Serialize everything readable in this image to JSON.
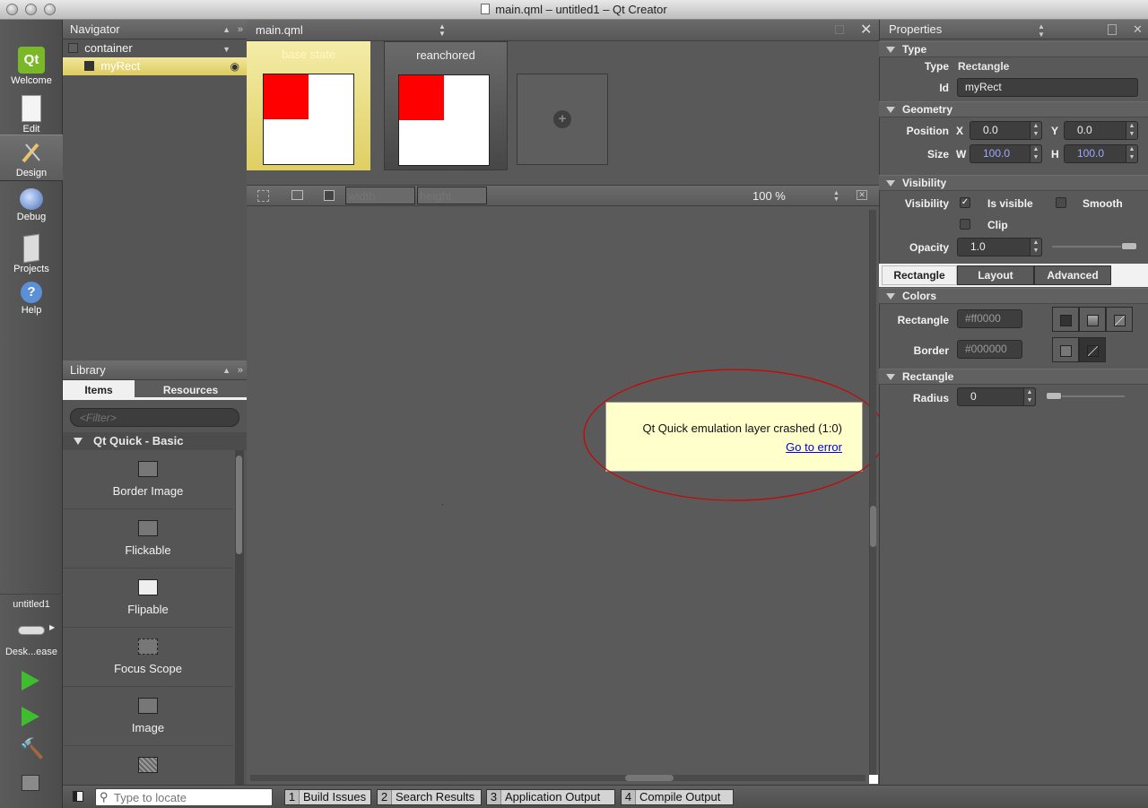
{
  "window": {
    "title": "main.qml – untitled1 – Qt Creator"
  },
  "modes": [
    {
      "label": "Welcome"
    },
    {
      "label": "Edit"
    },
    {
      "label": "Design"
    },
    {
      "label": "Debug"
    },
    {
      "label": "Projects"
    },
    {
      "label": "Help"
    }
  ],
  "modes_logo": "Qt",
  "kit": {
    "project": "untitled1",
    "target": "Desk...ease"
  },
  "navigator": {
    "title": "Navigator",
    "items": [
      {
        "label": "container"
      },
      {
        "label": "myRect"
      }
    ]
  },
  "library": {
    "title": "Library",
    "tabs": [
      "Items",
      "Resources"
    ],
    "filter_placeholder": "<Filter>",
    "group": "Qt Quick - Basic",
    "items": [
      {
        "label": "Border Image"
      },
      {
        "label": "Flickable"
      },
      {
        "label": "Flipable"
      },
      {
        "label": "Focus Scope"
      },
      {
        "label": "Image"
      }
    ]
  },
  "editor": {
    "file": "main.qml",
    "states": [
      {
        "label": "base state"
      },
      {
        "label": "reanchored"
      }
    ],
    "add_state_icon": "plus-circle-icon",
    "width_placeholder": "width",
    "height_placeholder": "height",
    "zoom": "100 %"
  },
  "error": {
    "message": "Qt Quick emulation layer crashed (1:0)",
    "link": "Go to error"
  },
  "properties": {
    "title": "Properties",
    "type_section": "Type",
    "type_label": "Type",
    "type_value": "Rectangle",
    "id_label": "Id",
    "id_value": "myRect",
    "geometry_section": "Geometry",
    "position_label": "Position",
    "x_label": "X",
    "x_value": "0.0",
    "y_label": "Y",
    "y_value": "0.0",
    "size_label": "Size",
    "w_label": "W",
    "w_value": "100.0",
    "h_label": "H",
    "h_value": "100.0",
    "visibility_section": "Visibility",
    "visibility_label": "Visibility",
    "is_visible": "Is visible",
    "smooth": "Smooth",
    "clip": "Clip",
    "opacity_label": "Opacity",
    "opacity_value": "1.0",
    "tabs": [
      "Rectangle",
      "Layout",
      "Advanced"
    ],
    "colors_section": "Colors",
    "rect_color_label": "Rectangle",
    "rect_color_value": "#ff0000",
    "border_color_label": "Border",
    "border_color_value": "#000000",
    "rectangle_section": "Rectangle",
    "radius_label": "Radius",
    "radius_value": "0"
  },
  "statusbar": {
    "locate_placeholder": "Type to locate",
    "panes": [
      {
        "num": "1",
        "label": "Build Issues"
      },
      {
        "num": "2",
        "label": "Search Results"
      },
      {
        "num": "3",
        "label": "Application Output"
      },
      {
        "num": "4",
        "label": "Compile Output"
      }
    ]
  },
  "colors": {
    "accent_red": "#ff0000",
    "selection_yellow": "#e8d97a",
    "tooltip_bg": "#ffffcc"
  }
}
